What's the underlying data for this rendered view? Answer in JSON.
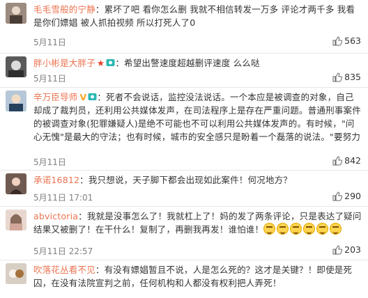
{
  "comments": [
    {
      "name": "毛毛雪般的宁静",
      "text": "累坏了吧 看你怎么删 我就不相信转发一万多 评论才两千多 我看是你们嫖娼 被人抓拍视频 所以打死人了0",
      "time": "5月11日",
      "likes": "563"
    },
    {
      "name": "胖小彬是大胖子",
      "badge": "★",
      "text": "希望出警速度超越删评速度 么么哒",
      "time": "5月11日",
      "likes": "835"
    },
    {
      "name": "辛万臣导师",
      "badge": "V",
      "text": "死者不会说话，监控没法说话。一个本应是被调查的对象，自己却成了裁判员，还利用公共媒体发声，在司法程序上是存在严重问题。普通刑事案件的被调查对象(犯罪嫌疑人)是绝不可能也不可以利用公共媒体发声的。有时候，\"问心无愧\"是最大的守法；也有时候，城市的安全感只是盼着一个磊落的说法。\"要努力",
      "time": "5月11日",
      "likes": "842"
    },
    {
      "name": "承诺16812",
      "text": "我只想说，天子脚下都会出现如此案件！何况地方？",
      "time": "5月11日 17:01",
      "likes": "290"
    },
    {
      "name": "abvictoria",
      "text": "我就是没事怎么了！我就杠上了！妈的发了两条评论，只是表达了疑问结果又被删了！在干什么！复制了，再删我再发！谁怕谁！",
      "time": "5月11日 22:57",
      "likes": "203"
    },
    {
      "name": "吹落花丛看不见",
      "text": "有没有嫖娼暂且不说，人是怎么死的？这才是关键？！即使是死囚，在没有法院宣判之前，任何机构和人都没有权利把人弄死！",
      "time": "",
      "likes": ""
    }
  ],
  "colors": {
    "name": "#eb7350",
    "text": "#333333",
    "time": "#808080"
  },
  "icons": {
    "like": "thumb-up-icon",
    "chat": "camera-icon",
    "emoji": "smile-emoji-icon"
  }
}
